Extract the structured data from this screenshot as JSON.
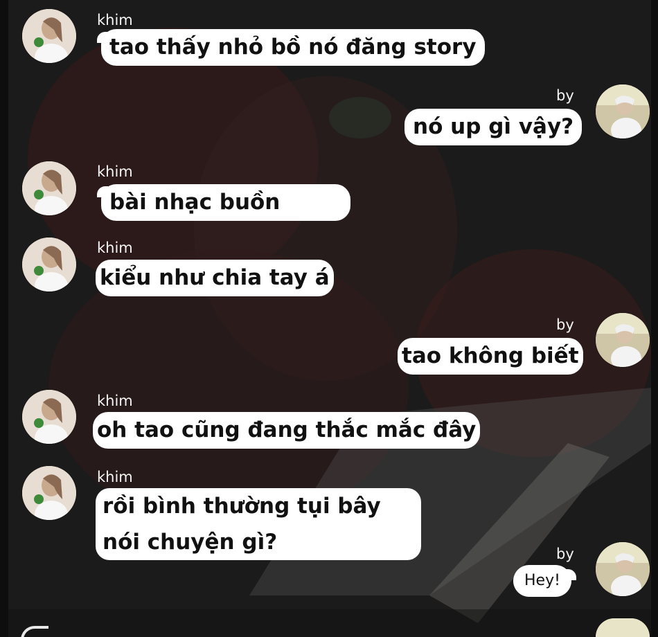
{
  "users": {
    "khim": "khim",
    "by": "by"
  },
  "messages": [
    {
      "sender": "khim",
      "text": "tao thấy nhỏ bồ nó đăng story"
    },
    {
      "sender": "by",
      "text": "nó up gì vậy?"
    },
    {
      "sender": "khim",
      "text": "bài nhạc buồn"
    },
    {
      "sender": "khim",
      "text": "kiểu như chia tay á"
    },
    {
      "sender": "by",
      "text": "tao không biết"
    },
    {
      "sender": "khim",
      "text": "oh tao cũng đang thắc mắc đây"
    },
    {
      "sender": "khim",
      "text": "rồi bình thường tụi bây nói chuyện gì?"
    },
    {
      "sender": "by",
      "text": "Hey!"
    }
  ],
  "colors": {
    "bubble": "#ffffff",
    "background": "#1b1b1b",
    "name_text": "#f4f4f4"
  }
}
